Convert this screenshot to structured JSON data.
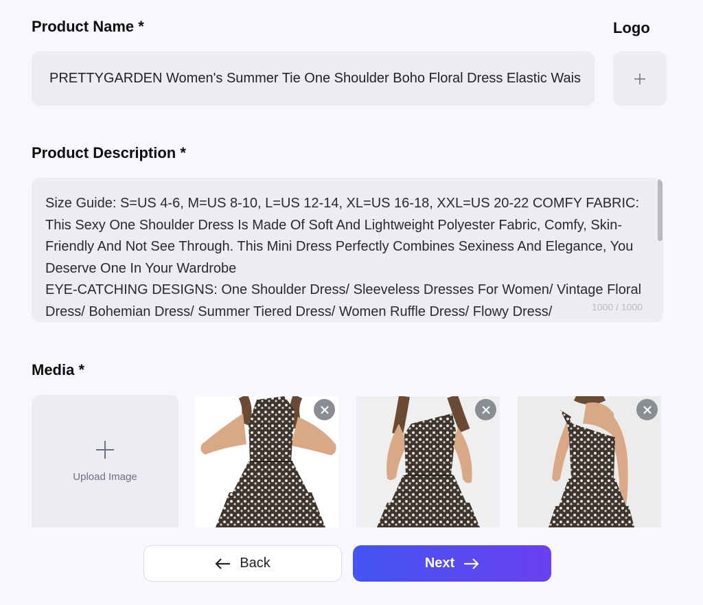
{
  "product_name": {
    "label": "Product Name *",
    "value": "PRETTYGARDEN Women's Summer Tie One Shoulder Boho Floral Dress Elastic Waist Ruffle Tiered Mini Dress"
  },
  "logo": {
    "label": "Logo",
    "add_icon": "plus-icon"
  },
  "product_description": {
    "label": "Product Description *",
    "value": "Size Guide: S=US 4-6, M=US 8-10, L=US 12-14, XL=US 16-18, XXL=US 20-22 COMFY FABRIC: This Sexy One Shoulder Dress Is Made Of Soft And Lightweight Polyester Fabric, Comfy, Skin-Friendly And Not See Through. This Mini Dress Perfectly Combines Sexiness And Elegance, You Deserve One In Your Wardrobe\nEYE-CATCHING DESIGNS: One Shoulder Dress/ Sleeveless Dresses For Women/ Vintage Floral Dress/ Bohemian Dress/ Summer Tiered Dress/ Women Ruffle Dress/ Flowy Dress/",
    "counter": "1000 / 1000"
  },
  "media": {
    "label": "Media *",
    "upload_label": "Upload Image",
    "images": [
      {
        "name": "media-image-front-hands-on-hips",
        "remove_icon": "close-icon"
      },
      {
        "name": "media-image-front-standing",
        "remove_icon": "close-icon"
      },
      {
        "name": "media-image-back-view",
        "remove_icon": "close-icon"
      }
    ]
  },
  "actions": {
    "back_label": "Back",
    "next_label": "Next"
  }
}
